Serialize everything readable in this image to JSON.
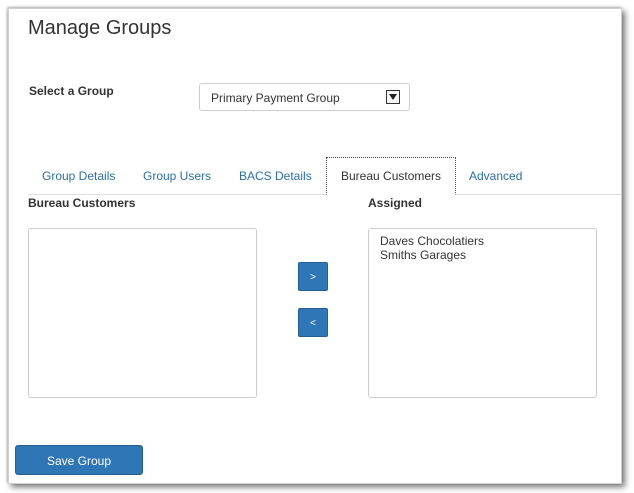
{
  "page": {
    "title": "Manage Groups"
  },
  "group_selector": {
    "label": "Select a Group",
    "selected": "Primary Payment Group",
    "icon": "chevron-down-icon"
  },
  "tabs": [
    {
      "label": "Group Details",
      "active": false
    },
    {
      "label": "Group Users",
      "active": false
    },
    {
      "label": "BACS Details",
      "active": false
    },
    {
      "label": "Bureau Customers",
      "active": true
    },
    {
      "label": "Advanced",
      "active": false
    }
  ],
  "bureau_customers": {
    "heading": "Bureau Customers",
    "items": []
  },
  "assigned": {
    "heading": "Assigned",
    "items": [
      "Daves Chocolatiers",
      "Smiths Garages"
    ]
  },
  "buttons": {
    "add_label": ">",
    "remove_label": "<",
    "save_label": "Save Group"
  },
  "colors": {
    "accent": "#2f76b6",
    "link": "#2a6fa8"
  }
}
